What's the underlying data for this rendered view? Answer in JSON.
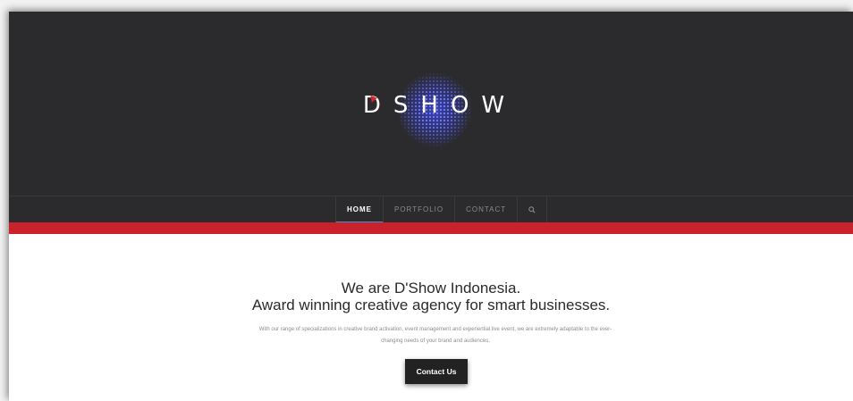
{
  "logo": {
    "text": "D'SHOW",
    "letters": "DSHOW"
  },
  "nav": {
    "items": [
      {
        "label": "HOME",
        "active": true
      },
      {
        "label": "PORTFOLIO",
        "active": false
      },
      {
        "label": "CONTACT",
        "active": false
      }
    ],
    "search_icon": "search-icon"
  },
  "hero": {
    "headline_line1": "We are D'Show Indonesia.",
    "headline_line2": "Award winning creative agency for smart businesses.",
    "description_line1": "With our range of specializations in creative brand activation, event management and experiential live event, we are extremely adaptable to the ever-",
    "description_line2": "changing needs of your brand and audiences.",
    "cta_label": "Contact Us"
  },
  "colors": {
    "header_bg": "#2b2b2d",
    "accent_red": "#c9222b",
    "nav_active_underline": "#3a8fd8",
    "button_bg": "#222222"
  }
}
